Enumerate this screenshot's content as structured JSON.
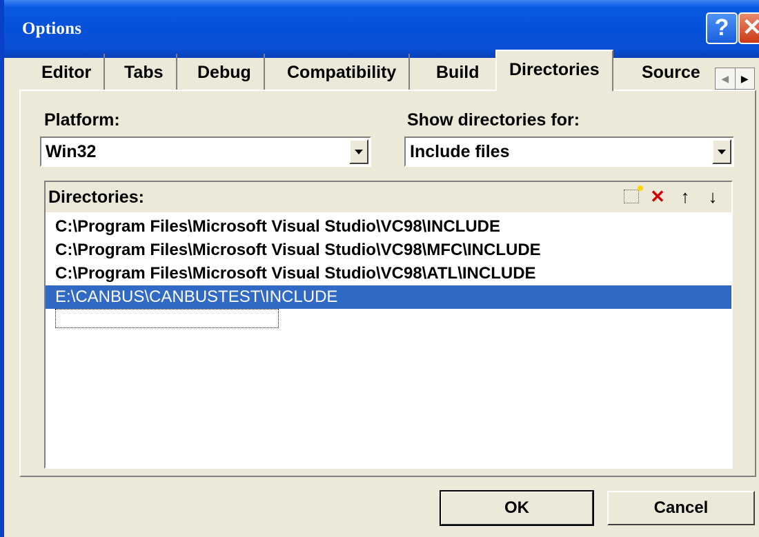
{
  "window": {
    "title": "Options",
    "help_glyph": "?",
    "close_glyph": "✕"
  },
  "tabs": [
    {
      "label": "Editor",
      "active": false
    },
    {
      "label": "Tabs",
      "active": false
    },
    {
      "label": "Debug",
      "active": false
    },
    {
      "label": "Compatibility",
      "active": false
    },
    {
      "label": "Build",
      "active": false
    },
    {
      "label": "Directories",
      "active": true
    },
    {
      "label": "Source",
      "active": false
    }
  ],
  "platform": {
    "label": "Platform:",
    "value": "Win32"
  },
  "show_for": {
    "label": "Show directories for:",
    "value": "Include files"
  },
  "directories": {
    "label": "Directories:",
    "items": [
      "C:\\Program Files\\Microsoft Visual Studio\\VC98\\INCLUDE",
      "C:\\Program Files\\Microsoft Visual Studio\\VC98\\MFC\\INCLUDE",
      "C:\\Program Files\\Microsoft Visual Studio\\VC98\\ATL\\INCLUDE",
      "E:\\CANBUS\\CANBUSTEST\\INCLUDE"
    ],
    "selected_index": 3,
    "toolbar_icons": [
      "new-folder-icon",
      "delete-icon",
      "move-up-icon",
      "move-down-icon"
    ]
  },
  "buttons": {
    "ok": "OK",
    "cancel": "Cancel"
  },
  "colors": {
    "selection": "#316ac5",
    "titlebar": "#0a5be2",
    "dialog_bg": "#ece9d8"
  }
}
